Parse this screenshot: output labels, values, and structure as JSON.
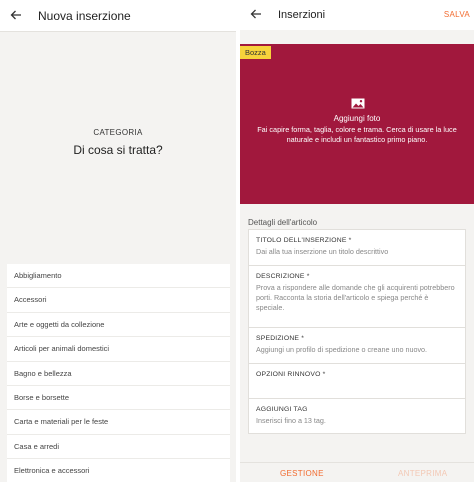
{
  "left": {
    "title": "Nuova inserzione",
    "hero_label": "CATEGORIA",
    "hero_question": "Di cosa si tratta?",
    "categories": [
      "Abbigliamento",
      "Accessori",
      "Arte e oggetti da collezione",
      "Articoli per animali domestici",
      "Bagno e bellezza",
      "Borse e borsette",
      "Carta e materiali per le feste",
      "Casa e arredi",
      "Elettronica e accessori"
    ]
  },
  "right": {
    "title": "Inserzioni",
    "save_label": "SALVA",
    "draft_badge": "Bozza",
    "add_photo": "Aggiungi foto",
    "photo_hint": "Fai capire forma, taglia, colore e trama. Cerca di usare la luce naturale e includi un fantastico primo piano.",
    "section_label": "Dettagli dell'articolo",
    "fields": [
      {
        "label": "TITOLO DELL'INSERZIONE *",
        "value": "Dai alla tua inserzione un titolo descrittivo"
      },
      {
        "label": "DESCRIZIONE *",
        "value": "Prova a rispondere alle domande che gli acquirenti potrebbero porti. Racconta la storia dell'articolo e spiega perché è speciale."
      },
      {
        "label": "SPEDIZIONE *",
        "value": "Aggiungi un profilo di spedizione o creane uno nuovo."
      },
      {
        "label": "OPZIONI RINNOVO *",
        "value": ""
      },
      {
        "label": "AGGIUNGI TAG",
        "value": "Inserisci fino a 13 tag."
      }
    ],
    "bottom_tabs": {
      "manage": "GESTIONE",
      "preview": "ANTEPRIMA"
    }
  },
  "colors": {
    "accent": "#f26b2f",
    "photo_bg": "#a1183d",
    "badge": "#f7d23b",
    "panel_bg": "#f4f3f1"
  }
}
